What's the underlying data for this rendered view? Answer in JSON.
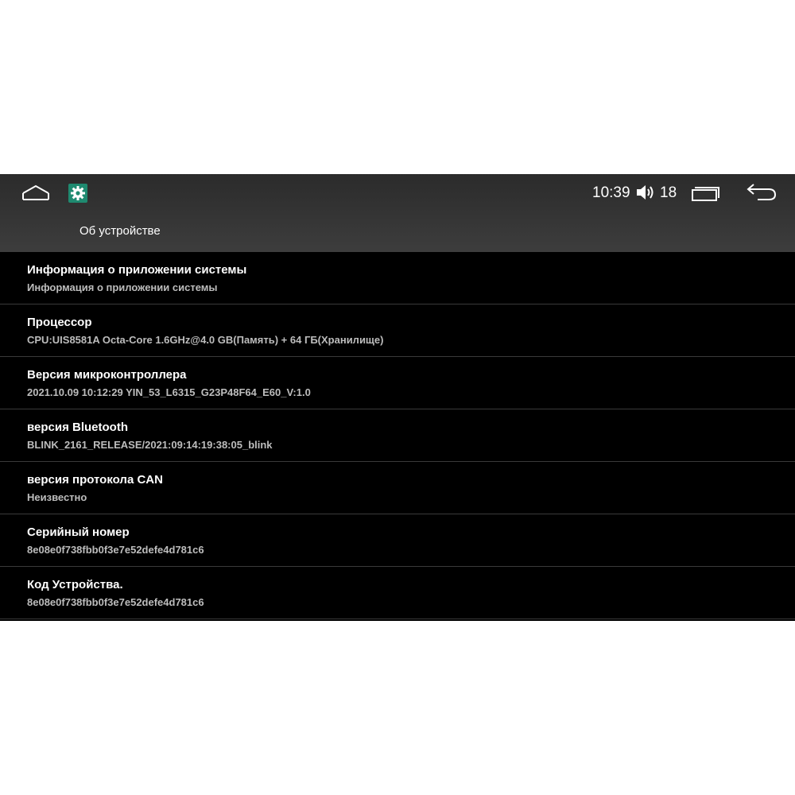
{
  "status_bar": {
    "time": "10:39",
    "volume_level": "18",
    "icons": {
      "home": "home-icon",
      "app": "settings-gear-icon",
      "volume": "volume-icon",
      "recents": "recents-icon",
      "back": "back-arrow-icon"
    },
    "colors": {
      "app_icon_bg": "#1f8a70",
      "header_bg": "#363636"
    }
  },
  "header": {
    "title": "Об устройстве"
  },
  "items": [
    {
      "title": "Информация о приложении системы",
      "value": "Информация о приложении системы"
    },
    {
      "title": "Процессор",
      "value": "CPU:UIS8581A Octa-Core 1.6GHz@4.0 GB(Память) + 64 ГБ(Хранилище)"
    },
    {
      "title": "Версия микроконтроллера",
      "value": "2021.10.09 10:12:29 YIN_53_L6315_G23P48F64_E60_V:1.0"
    },
    {
      "title": "версия Bluetooth",
      "value": "BLINK_2161_RELEASE/2021:09:14:19:38:05_blink"
    },
    {
      "title": "версия протокола CAN",
      "value": "Неизвестно"
    },
    {
      "title": "Серийный номер",
      "value": "8e08e0f738fbb0f3e7e52defe4d781c6"
    },
    {
      "title": "Код Устройства.",
      "value": "8e08e0f738fbb0f3e7e52defe4d781c6"
    }
  ]
}
